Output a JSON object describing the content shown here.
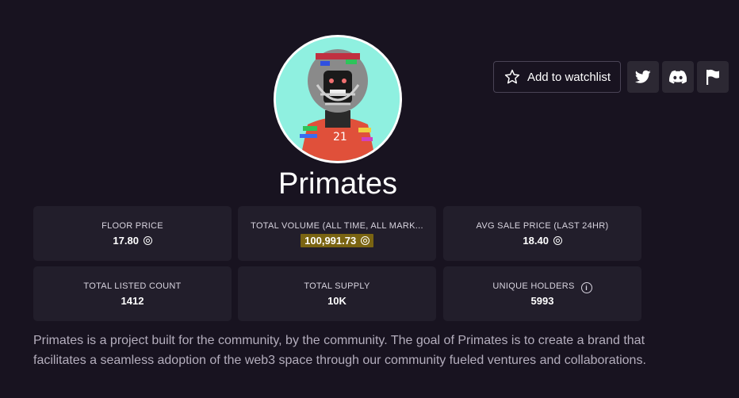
{
  "collection": {
    "name": "Primates",
    "description": "Primates is a project built for the community, by the community. The goal of Primates is to create a brand that facilitates a seamless adoption of the web3 space through our community fueled ventures and collaborations."
  },
  "actions": {
    "watchlist_label": "Add to watchlist",
    "icons": [
      "star-icon",
      "twitter-icon",
      "discord-icon",
      "flag-icon"
    ]
  },
  "stats": [
    {
      "label": "FLOOR PRICE",
      "value": "17.80"
    },
    {
      "label": "TOTAL VOLUME (ALL TIME, ALL MARK...",
      "value": "100,991.73"
    },
    {
      "label": "AVG SALE PRICE (LAST 24HR)",
      "value": "18.40"
    },
    {
      "label": "TOTAL LISTED COUNT",
      "value": "1412"
    },
    {
      "label": "TOTAL SUPPLY",
      "value": "10K"
    },
    {
      "label": "UNIQUE HOLDERS",
      "value": "5993"
    }
  ],
  "colors": {
    "background": "#181320",
    "card": "#221e2b",
    "highlight": "#7a6412",
    "avatar_bg": "#8ff0e0"
  }
}
